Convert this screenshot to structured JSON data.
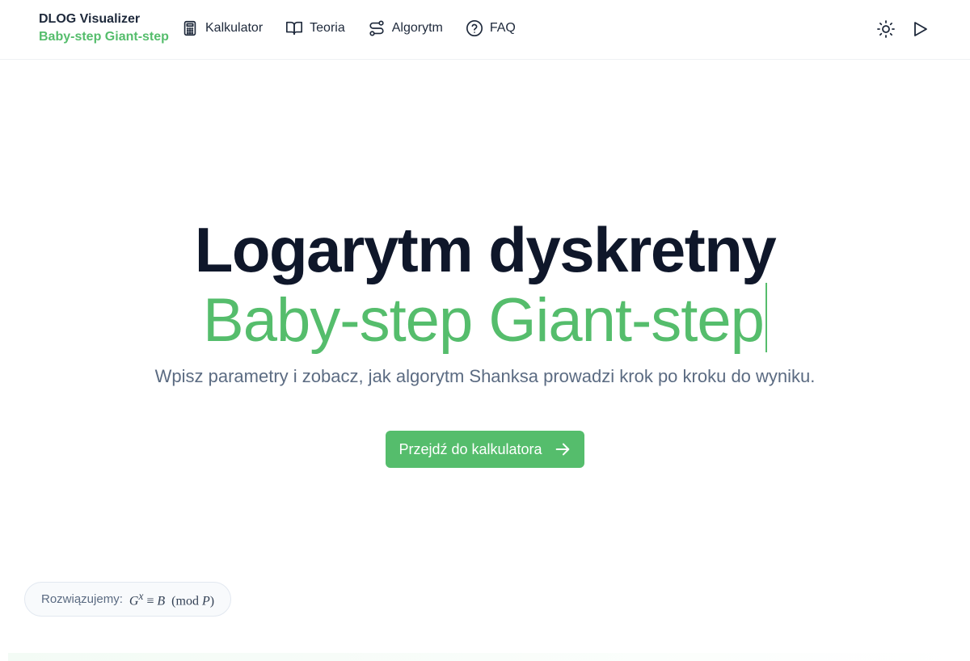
{
  "brand": {
    "title": "DLOG Visualizer",
    "subtitle": "Baby-step Giant-step"
  },
  "nav": {
    "items": [
      {
        "label": "Kalkulator",
        "icon": "calculator-icon"
      },
      {
        "label": "Teoria",
        "icon": "book-icon"
      },
      {
        "label": "Algorytm",
        "icon": "route-icon"
      },
      {
        "label": "FAQ",
        "icon": "help-circle-icon"
      }
    ]
  },
  "actions": {
    "theme_icon": "sun-icon",
    "play_icon": "play-icon"
  },
  "hero": {
    "title": "Logarytm dyskretny",
    "subtitle": "Baby-step Giant-step",
    "description": "Wpisz parametry i zobacz, jak algorytm Shanksa prowadzi krok po kroku do wyniku.",
    "cta_label": "Przejdź do kalkulatora"
  },
  "equation": {
    "label": "Rozwiązujemy:",
    "G": "G",
    "x": "x",
    "equiv": "≡",
    "B": "B",
    "mod_open": "(mod",
    "P": "P",
    "mod_close": ")"
  },
  "colors": {
    "accent": "#55bd6c",
    "text": "#0f172a",
    "muted": "#5b6b82"
  }
}
